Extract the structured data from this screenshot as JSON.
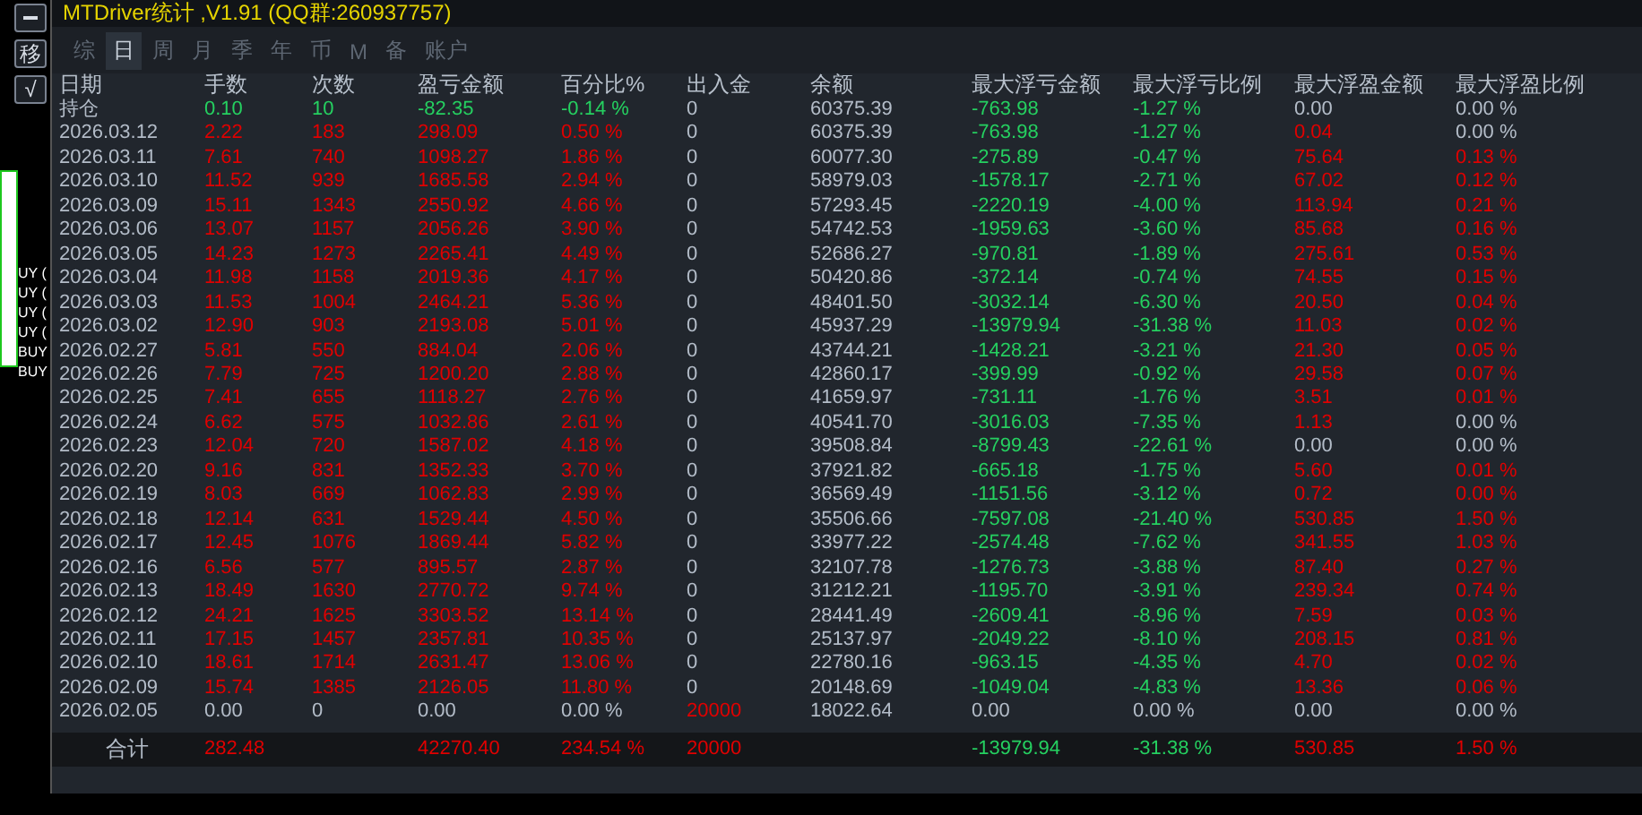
{
  "side_buttons": [
    {
      "kind": "minus"
    },
    {
      "kind": "text",
      "label": "移"
    },
    {
      "kind": "text",
      "label": "√"
    }
  ],
  "chart_labels": [
    "UY (",
    "UY (",
    "UY (",
    "UY (",
    "BUY",
    "BUY"
  ],
  "window": {
    "title": "MTDriver统计 ,V1.91 (QQ群:260937757)"
  },
  "tabs": [
    {
      "label": "综",
      "selected": false
    },
    {
      "label": "日",
      "selected": true
    },
    {
      "label": "周",
      "selected": false
    },
    {
      "label": "月",
      "selected": false
    },
    {
      "label": "季",
      "selected": false
    },
    {
      "label": "年",
      "selected": false
    },
    {
      "label": "币",
      "selected": false
    },
    {
      "label": "M",
      "selected": false
    },
    {
      "label": "备",
      "selected": false
    },
    {
      "label": "账户",
      "selected": false
    }
  ],
  "table": {
    "columns": [
      "日期",
      "手数",
      "次数",
      "盈亏金额",
      "百分比%",
      "出入金",
      "余额",
      "最大浮亏金额",
      "最大浮亏比例",
      "最大浮盈金额",
      "最大浮盈比例"
    ],
    "rows": [
      {
        "cells": [
          {
            "text": "持仓",
            "kind": "flat"
          },
          {
            "text": "0.10",
            "kind": "down"
          },
          {
            "text": "10",
            "kind": "down"
          },
          {
            "text": "-82.35",
            "kind": "down"
          },
          {
            "text": "-0.14 %",
            "kind": "down"
          },
          {
            "text": "0",
            "kind": "flat"
          },
          {
            "text": "60375.39",
            "kind": "flat"
          },
          {
            "text": "-763.98",
            "kind": "down"
          },
          {
            "text": "-1.27 %",
            "kind": "down"
          },
          {
            "text": "0.00",
            "kind": "flat"
          },
          {
            "text": "0.00 %",
            "kind": "flat"
          }
        ]
      },
      {
        "cells": [
          {
            "text": "2026.03.12",
            "kind": "flat"
          },
          {
            "text": "2.22",
            "kind": "up"
          },
          {
            "text": "183",
            "kind": "up"
          },
          {
            "text": "298.09",
            "kind": "up"
          },
          {
            "text": "0.50 %",
            "kind": "up"
          },
          {
            "text": "0",
            "kind": "flat"
          },
          {
            "text": "60375.39",
            "kind": "flat"
          },
          {
            "text": "-763.98",
            "kind": "down"
          },
          {
            "text": "-1.27 %",
            "kind": "down"
          },
          {
            "text": "0.04",
            "kind": "up"
          },
          {
            "text": "0.00 %",
            "kind": "flat"
          }
        ]
      },
      {
        "cells": [
          {
            "text": "2026.03.11",
            "kind": "flat"
          },
          {
            "text": "7.61",
            "kind": "up"
          },
          {
            "text": "740",
            "kind": "up"
          },
          {
            "text": "1098.27",
            "kind": "up"
          },
          {
            "text": "1.86 %",
            "kind": "up"
          },
          {
            "text": "0",
            "kind": "flat"
          },
          {
            "text": "60077.30",
            "kind": "flat"
          },
          {
            "text": "-275.89",
            "kind": "down"
          },
          {
            "text": "-0.47 %",
            "kind": "down"
          },
          {
            "text": "75.64",
            "kind": "up"
          },
          {
            "text": "0.13 %",
            "kind": "up"
          }
        ]
      },
      {
        "cells": [
          {
            "text": "2026.03.10",
            "kind": "flat"
          },
          {
            "text": "11.52",
            "kind": "up"
          },
          {
            "text": "939",
            "kind": "up"
          },
          {
            "text": "1685.58",
            "kind": "up"
          },
          {
            "text": "2.94 %",
            "kind": "up"
          },
          {
            "text": "0",
            "kind": "flat"
          },
          {
            "text": "58979.03",
            "kind": "flat"
          },
          {
            "text": "-1578.17",
            "kind": "down"
          },
          {
            "text": "-2.71 %",
            "kind": "down"
          },
          {
            "text": "67.02",
            "kind": "up"
          },
          {
            "text": "0.12 %",
            "kind": "up"
          }
        ]
      },
      {
        "cells": [
          {
            "text": "2026.03.09",
            "kind": "flat"
          },
          {
            "text": "15.11",
            "kind": "up"
          },
          {
            "text": "1343",
            "kind": "up"
          },
          {
            "text": "2550.92",
            "kind": "up"
          },
          {
            "text": "4.66 %",
            "kind": "up"
          },
          {
            "text": "0",
            "kind": "flat"
          },
          {
            "text": "57293.45",
            "kind": "flat"
          },
          {
            "text": "-2220.19",
            "kind": "down"
          },
          {
            "text": "-4.00 %",
            "kind": "down"
          },
          {
            "text": "113.94",
            "kind": "up"
          },
          {
            "text": "0.21 %",
            "kind": "up"
          }
        ]
      },
      {
        "cells": [
          {
            "text": "2026.03.06",
            "kind": "flat"
          },
          {
            "text": "13.07",
            "kind": "up"
          },
          {
            "text": "1157",
            "kind": "up"
          },
          {
            "text": "2056.26",
            "kind": "up"
          },
          {
            "text": "3.90 %",
            "kind": "up"
          },
          {
            "text": "0",
            "kind": "flat"
          },
          {
            "text": "54742.53",
            "kind": "flat"
          },
          {
            "text": "-1959.63",
            "kind": "down"
          },
          {
            "text": "-3.60 %",
            "kind": "down"
          },
          {
            "text": "85.68",
            "kind": "up"
          },
          {
            "text": "0.16 %",
            "kind": "up"
          }
        ]
      },
      {
        "cells": [
          {
            "text": "2026.03.05",
            "kind": "flat"
          },
          {
            "text": "14.23",
            "kind": "up"
          },
          {
            "text": "1273",
            "kind": "up"
          },
          {
            "text": "2265.41",
            "kind": "up"
          },
          {
            "text": "4.49 %",
            "kind": "up"
          },
          {
            "text": "0",
            "kind": "flat"
          },
          {
            "text": "52686.27",
            "kind": "flat"
          },
          {
            "text": "-970.81",
            "kind": "down"
          },
          {
            "text": "-1.89 %",
            "kind": "down"
          },
          {
            "text": "275.61",
            "kind": "up"
          },
          {
            "text": "0.53 %",
            "kind": "up"
          }
        ]
      },
      {
        "cells": [
          {
            "text": "2026.03.04",
            "kind": "flat"
          },
          {
            "text": "11.98",
            "kind": "up"
          },
          {
            "text": "1158",
            "kind": "up"
          },
          {
            "text": "2019.36",
            "kind": "up"
          },
          {
            "text": "4.17 %",
            "kind": "up"
          },
          {
            "text": "0",
            "kind": "flat"
          },
          {
            "text": "50420.86",
            "kind": "flat"
          },
          {
            "text": "-372.14",
            "kind": "down"
          },
          {
            "text": "-0.74 %",
            "kind": "down"
          },
          {
            "text": "74.55",
            "kind": "up"
          },
          {
            "text": "0.15 %",
            "kind": "up"
          }
        ]
      },
      {
        "cells": [
          {
            "text": "2026.03.03",
            "kind": "flat"
          },
          {
            "text": "11.53",
            "kind": "up"
          },
          {
            "text": "1004",
            "kind": "up"
          },
          {
            "text": "2464.21",
            "kind": "up"
          },
          {
            "text": "5.36 %",
            "kind": "up"
          },
          {
            "text": "0",
            "kind": "flat"
          },
          {
            "text": "48401.50",
            "kind": "flat"
          },
          {
            "text": "-3032.14",
            "kind": "down"
          },
          {
            "text": "-6.30 %",
            "kind": "down"
          },
          {
            "text": "20.50",
            "kind": "up"
          },
          {
            "text": "0.04 %",
            "kind": "up"
          }
        ]
      },
      {
        "cells": [
          {
            "text": "2026.03.02",
            "kind": "flat"
          },
          {
            "text": "12.90",
            "kind": "up"
          },
          {
            "text": "903",
            "kind": "up"
          },
          {
            "text": "2193.08",
            "kind": "up"
          },
          {
            "text": "5.01 %",
            "kind": "up"
          },
          {
            "text": "0",
            "kind": "flat"
          },
          {
            "text": "45937.29",
            "kind": "flat"
          },
          {
            "text": "-13979.94",
            "kind": "down"
          },
          {
            "text": "-31.38 %",
            "kind": "down"
          },
          {
            "text": "11.03",
            "kind": "up"
          },
          {
            "text": "0.02 %",
            "kind": "up"
          }
        ]
      },
      {
        "cells": [
          {
            "text": "2026.02.27",
            "kind": "flat"
          },
          {
            "text": "5.81",
            "kind": "up"
          },
          {
            "text": "550",
            "kind": "up"
          },
          {
            "text": "884.04",
            "kind": "up"
          },
          {
            "text": "2.06 %",
            "kind": "up"
          },
          {
            "text": "0",
            "kind": "flat"
          },
          {
            "text": "43744.21",
            "kind": "flat"
          },
          {
            "text": "-1428.21",
            "kind": "down"
          },
          {
            "text": "-3.21 %",
            "kind": "down"
          },
          {
            "text": "21.30",
            "kind": "up"
          },
          {
            "text": "0.05 %",
            "kind": "up"
          }
        ]
      },
      {
        "cells": [
          {
            "text": "2026.02.26",
            "kind": "flat"
          },
          {
            "text": "7.79",
            "kind": "up"
          },
          {
            "text": "725",
            "kind": "up"
          },
          {
            "text": "1200.20",
            "kind": "up"
          },
          {
            "text": "2.88 %",
            "kind": "up"
          },
          {
            "text": "0",
            "kind": "flat"
          },
          {
            "text": "42860.17",
            "kind": "flat"
          },
          {
            "text": "-399.99",
            "kind": "down"
          },
          {
            "text": "-0.92 %",
            "kind": "down"
          },
          {
            "text": "29.58",
            "kind": "up"
          },
          {
            "text": "0.07 %",
            "kind": "up"
          }
        ]
      },
      {
        "cells": [
          {
            "text": "2026.02.25",
            "kind": "flat"
          },
          {
            "text": "7.41",
            "kind": "up"
          },
          {
            "text": "655",
            "kind": "up"
          },
          {
            "text": "1118.27",
            "kind": "up"
          },
          {
            "text": "2.76 %",
            "kind": "up"
          },
          {
            "text": "0",
            "kind": "flat"
          },
          {
            "text": "41659.97",
            "kind": "flat"
          },
          {
            "text": "-731.11",
            "kind": "down"
          },
          {
            "text": "-1.76 %",
            "kind": "down"
          },
          {
            "text": "3.51",
            "kind": "up"
          },
          {
            "text": "0.01 %",
            "kind": "up"
          }
        ]
      },
      {
        "cells": [
          {
            "text": "2026.02.24",
            "kind": "flat"
          },
          {
            "text": "6.62",
            "kind": "up"
          },
          {
            "text": "575",
            "kind": "up"
          },
          {
            "text": "1032.86",
            "kind": "up"
          },
          {
            "text": "2.61 %",
            "kind": "up"
          },
          {
            "text": "0",
            "kind": "flat"
          },
          {
            "text": "40541.70",
            "kind": "flat"
          },
          {
            "text": "-3016.03",
            "kind": "down"
          },
          {
            "text": "-7.35 %",
            "kind": "down"
          },
          {
            "text": "1.13",
            "kind": "up"
          },
          {
            "text": "0.00 %",
            "kind": "flat"
          }
        ]
      },
      {
        "cells": [
          {
            "text": "2026.02.23",
            "kind": "flat"
          },
          {
            "text": "12.04",
            "kind": "up"
          },
          {
            "text": "720",
            "kind": "up"
          },
          {
            "text": "1587.02",
            "kind": "up"
          },
          {
            "text": "4.18 %",
            "kind": "up"
          },
          {
            "text": "0",
            "kind": "flat"
          },
          {
            "text": "39508.84",
            "kind": "flat"
          },
          {
            "text": "-8799.43",
            "kind": "down"
          },
          {
            "text": "-22.61 %",
            "kind": "down"
          },
          {
            "text": "0.00",
            "kind": "flat"
          },
          {
            "text": "0.00 %",
            "kind": "flat"
          }
        ]
      },
      {
        "cells": [
          {
            "text": "2026.02.20",
            "kind": "flat"
          },
          {
            "text": "9.16",
            "kind": "up"
          },
          {
            "text": "831",
            "kind": "up"
          },
          {
            "text": "1352.33",
            "kind": "up"
          },
          {
            "text": "3.70 %",
            "kind": "up"
          },
          {
            "text": "0",
            "kind": "flat"
          },
          {
            "text": "37921.82",
            "kind": "flat"
          },
          {
            "text": "-665.18",
            "kind": "down"
          },
          {
            "text": "-1.75 %",
            "kind": "down"
          },
          {
            "text": "5.60",
            "kind": "up"
          },
          {
            "text": "0.01 %",
            "kind": "up"
          }
        ]
      },
      {
        "cells": [
          {
            "text": "2026.02.19",
            "kind": "flat"
          },
          {
            "text": "8.03",
            "kind": "up"
          },
          {
            "text": "669",
            "kind": "up"
          },
          {
            "text": "1062.83",
            "kind": "up"
          },
          {
            "text": "2.99 %",
            "kind": "up"
          },
          {
            "text": "0",
            "kind": "flat"
          },
          {
            "text": "36569.49",
            "kind": "flat"
          },
          {
            "text": "-1151.56",
            "kind": "down"
          },
          {
            "text": "-3.12 %",
            "kind": "down"
          },
          {
            "text": "0.72",
            "kind": "up"
          },
          {
            "text": "0.00 %",
            "kind": "up"
          }
        ]
      },
      {
        "cells": [
          {
            "text": "2026.02.18",
            "kind": "flat"
          },
          {
            "text": "12.14",
            "kind": "up"
          },
          {
            "text": "631",
            "kind": "up"
          },
          {
            "text": "1529.44",
            "kind": "up"
          },
          {
            "text": "4.50 %",
            "kind": "up"
          },
          {
            "text": "0",
            "kind": "flat"
          },
          {
            "text": "35506.66",
            "kind": "flat"
          },
          {
            "text": "-7597.08",
            "kind": "down"
          },
          {
            "text": "-21.40 %",
            "kind": "down"
          },
          {
            "text": "530.85",
            "kind": "up"
          },
          {
            "text": "1.50 %",
            "kind": "up"
          }
        ]
      },
      {
        "cells": [
          {
            "text": "2026.02.17",
            "kind": "flat"
          },
          {
            "text": "12.45",
            "kind": "up"
          },
          {
            "text": "1076",
            "kind": "up"
          },
          {
            "text": "1869.44",
            "kind": "up"
          },
          {
            "text": "5.82 %",
            "kind": "up"
          },
          {
            "text": "0",
            "kind": "flat"
          },
          {
            "text": "33977.22",
            "kind": "flat"
          },
          {
            "text": "-2574.48",
            "kind": "down"
          },
          {
            "text": "-7.62 %",
            "kind": "down"
          },
          {
            "text": "341.55",
            "kind": "up"
          },
          {
            "text": "1.03 %",
            "kind": "up"
          }
        ]
      },
      {
        "cells": [
          {
            "text": "2026.02.16",
            "kind": "flat"
          },
          {
            "text": "6.56",
            "kind": "up"
          },
          {
            "text": "577",
            "kind": "up"
          },
          {
            "text": "895.57",
            "kind": "up"
          },
          {
            "text": "2.87 %",
            "kind": "up"
          },
          {
            "text": "0",
            "kind": "flat"
          },
          {
            "text": "32107.78",
            "kind": "flat"
          },
          {
            "text": "-1276.73",
            "kind": "down"
          },
          {
            "text": "-3.88 %",
            "kind": "down"
          },
          {
            "text": "87.40",
            "kind": "up"
          },
          {
            "text": "0.27 %",
            "kind": "up"
          }
        ]
      },
      {
        "cells": [
          {
            "text": "2026.02.13",
            "kind": "flat"
          },
          {
            "text": "18.49",
            "kind": "up"
          },
          {
            "text": "1630",
            "kind": "up"
          },
          {
            "text": "2770.72",
            "kind": "up"
          },
          {
            "text": "9.74 %",
            "kind": "up"
          },
          {
            "text": "0",
            "kind": "flat"
          },
          {
            "text": "31212.21",
            "kind": "flat"
          },
          {
            "text": "-1195.70",
            "kind": "down"
          },
          {
            "text": "-3.91 %",
            "kind": "down"
          },
          {
            "text": "239.34",
            "kind": "up"
          },
          {
            "text": "0.74 %",
            "kind": "up"
          }
        ]
      },
      {
        "cells": [
          {
            "text": "2026.02.12",
            "kind": "flat"
          },
          {
            "text": "24.21",
            "kind": "up"
          },
          {
            "text": "1625",
            "kind": "up"
          },
          {
            "text": "3303.52",
            "kind": "up"
          },
          {
            "text": "13.14 %",
            "kind": "up"
          },
          {
            "text": "0",
            "kind": "flat"
          },
          {
            "text": "28441.49",
            "kind": "flat"
          },
          {
            "text": "-2609.41",
            "kind": "down"
          },
          {
            "text": "-8.96 %",
            "kind": "down"
          },
          {
            "text": "7.59",
            "kind": "up"
          },
          {
            "text": "0.03 %",
            "kind": "up"
          }
        ]
      },
      {
        "cells": [
          {
            "text": "2026.02.11",
            "kind": "flat"
          },
          {
            "text": "17.15",
            "kind": "up"
          },
          {
            "text": "1457",
            "kind": "up"
          },
          {
            "text": "2357.81",
            "kind": "up"
          },
          {
            "text": "10.35 %",
            "kind": "up"
          },
          {
            "text": "0",
            "kind": "flat"
          },
          {
            "text": "25137.97",
            "kind": "flat"
          },
          {
            "text": "-2049.22",
            "kind": "down"
          },
          {
            "text": "-8.10 %",
            "kind": "down"
          },
          {
            "text": "208.15",
            "kind": "up"
          },
          {
            "text": "0.81 %",
            "kind": "up"
          }
        ]
      },
      {
        "cells": [
          {
            "text": "2026.02.10",
            "kind": "flat"
          },
          {
            "text": "18.61",
            "kind": "up"
          },
          {
            "text": "1714",
            "kind": "up"
          },
          {
            "text": "2631.47",
            "kind": "up"
          },
          {
            "text": "13.06 %",
            "kind": "up"
          },
          {
            "text": "0",
            "kind": "flat"
          },
          {
            "text": "22780.16",
            "kind": "flat"
          },
          {
            "text": "-963.15",
            "kind": "down"
          },
          {
            "text": "-4.35 %",
            "kind": "down"
          },
          {
            "text": "4.70",
            "kind": "up"
          },
          {
            "text": "0.02 %",
            "kind": "up"
          }
        ]
      },
      {
        "cells": [
          {
            "text": "2026.02.09",
            "kind": "flat"
          },
          {
            "text": "15.74",
            "kind": "up"
          },
          {
            "text": "1385",
            "kind": "up"
          },
          {
            "text": "2126.05",
            "kind": "up"
          },
          {
            "text": "11.80 %",
            "kind": "up"
          },
          {
            "text": "0",
            "kind": "flat"
          },
          {
            "text": "20148.69",
            "kind": "flat"
          },
          {
            "text": "-1049.04",
            "kind": "down"
          },
          {
            "text": "-4.83 %",
            "kind": "down"
          },
          {
            "text": "13.36",
            "kind": "up"
          },
          {
            "text": "0.06 %",
            "kind": "up"
          }
        ]
      },
      {
        "cells": [
          {
            "text": "2026.02.05",
            "kind": "flat"
          },
          {
            "text": "0.00",
            "kind": "flat"
          },
          {
            "text": "0",
            "kind": "flat"
          },
          {
            "text": "0.00",
            "kind": "flat"
          },
          {
            "text": "0.00 %",
            "kind": "flat"
          },
          {
            "text": "20000",
            "kind": "up"
          },
          {
            "text": "18022.64",
            "kind": "flat"
          },
          {
            "text": "0.00",
            "kind": "flat"
          },
          {
            "text": "0.00 %",
            "kind": "flat"
          },
          {
            "text": "0.00",
            "kind": "flat"
          },
          {
            "text": "0.00 %",
            "kind": "flat"
          }
        ]
      }
    ],
    "total": {
      "cells": [
        {
          "text": "合计",
          "kind": "label"
        },
        {
          "text": "282.48",
          "kind": "up"
        },
        {
          "kind": "blank"
        },
        {
          "text": "42270.40",
          "kind": "up"
        },
        {
          "text": "234.54 %",
          "kind": "up"
        },
        {
          "text": "20000",
          "kind": "up"
        },
        {
          "kind": "blank"
        },
        {
          "text": "-13979.94",
          "kind": "down"
        },
        {
          "text": "-31.38 %",
          "kind": "down"
        },
        {
          "text": "530.85",
          "kind": "up"
        },
        {
          "text": "1.50 %",
          "kind": "up"
        }
      ]
    }
  }
}
